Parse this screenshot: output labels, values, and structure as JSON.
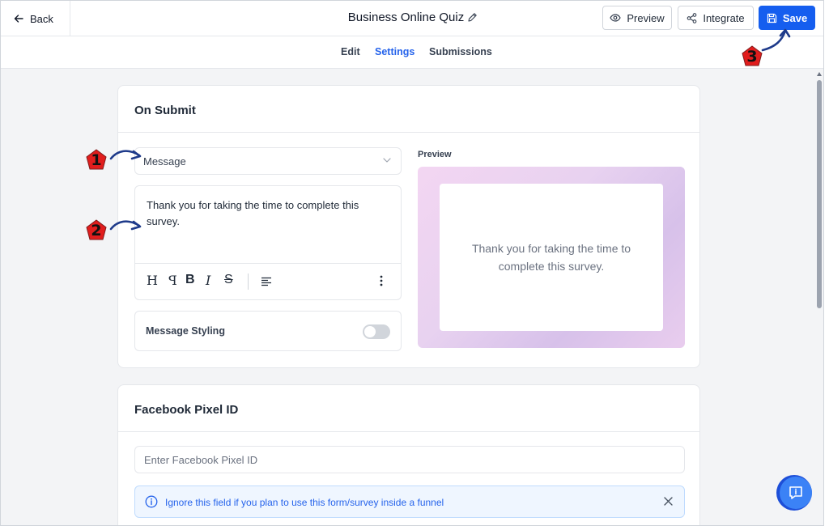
{
  "header": {
    "back_label": "Back",
    "title": "Business Online Quiz",
    "preview_label": "Preview",
    "integrate_label": "Integrate",
    "save_label": "Save"
  },
  "tabs": [
    {
      "label": "Edit",
      "active": false
    },
    {
      "label": "Settings",
      "active": true
    },
    {
      "label": "Submissions",
      "active": false
    }
  ],
  "on_submit": {
    "title": "On Submit",
    "select_value": "Message",
    "message_text": "Thank you for taking the time to complete this survey.",
    "toolbar": {
      "heading": "H",
      "paragraph": "ꟼ",
      "bold": "B",
      "italic": "I",
      "strike": "S"
    },
    "styling_label": "Message Styling",
    "styling_enabled": false,
    "preview_label": "Preview",
    "preview_text": "Thank you for taking the time to complete this survey."
  },
  "facebook_pixel": {
    "title": "Facebook Pixel ID",
    "placeholder": "Enter Facebook Pixel ID",
    "info_text": "Ignore this field if you plan to use this form/survey inside a funnel"
  },
  "steps": [
    "1",
    "2",
    "3"
  ],
  "colors": {
    "accent": "#155eef",
    "active_tab": "#2563eb",
    "info_bg": "#eff6ff",
    "marker": "#e11d1d",
    "arrow": "#1e3a8a"
  }
}
